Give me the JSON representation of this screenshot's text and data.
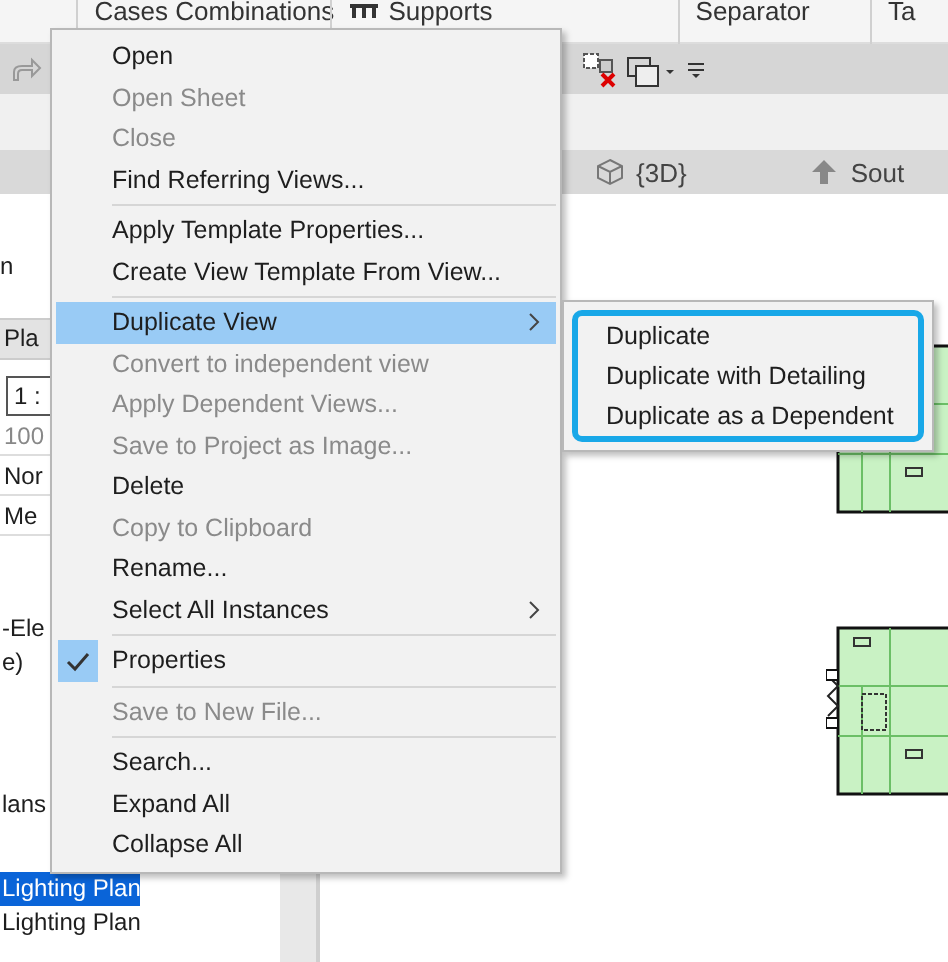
{
  "ribbon": {
    "groups": [
      {
        "label": "Cases  Combinations"
      },
      {
        "label": "Supports"
      },
      {
        "label": "Separator"
      },
      {
        "label": "Ta"
      }
    ]
  },
  "view_tabs": [
    {
      "label": "{3D}",
      "selected": false
    },
    {
      "label": "Sout",
      "selected": false
    }
  ],
  "properties_panel": {
    "text_1": "n",
    "header": "Pla",
    "scale_field": "1 :",
    "rows": [
      "100",
      "Nor",
      "Me"
    ]
  },
  "project_browser": {
    "items": [
      {
        "label": "-Ele",
        "selected": false
      },
      {
        "label": "e)",
        "selected": false
      },
      {
        "label": "lans",
        "selected": false
      },
      {
        "label": "Lighting Plan",
        "selected": true
      },
      {
        "label": "Lighting Plan",
        "selected": false
      }
    ]
  },
  "context_menu": {
    "items": [
      {
        "kind": "item",
        "label": "Open",
        "disabled": false,
        "selected": false,
        "checked": false,
        "submenu": false
      },
      {
        "kind": "item",
        "label": "Open Sheet",
        "disabled": true,
        "selected": false,
        "checked": false,
        "submenu": false
      },
      {
        "kind": "item",
        "label": "Close",
        "disabled": true,
        "selected": false,
        "checked": false,
        "submenu": false
      },
      {
        "kind": "item",
        "label": "Find Referring Views...",
        "disabled": false,
        "selected": false,
        "checked": false,
        "submenu": false
      },
      {
        "kind": "separator"
      },
      {
        "kind": "item",
        "label": "Apply Template Properties...",
        "disabled": false,
        "selected": false,
        "checked": false,
        "submenu": false
      },
      {
        "kind": "item",
        "label": "Create View Template From View...",
        "disabled": false,
        "selected": false,
        "checked": false,
        "submenu": false
      },
      {
        "kind": "separator"
      },
      {
        "kind": "item",
        "label": "Duplicate View",
        "disabled": false,
        "selected": true,
        "checked": false,
        "submenu": true
      },
      {
        "kind": "item",
        "label": "Convert to independent view",
        "disabled": true,
        "selected": false,
        "checked": false,
        "submenu": false
      },
      {
        "kind": "item",
        "label": "Apply Dependent Views...",
        "disabled": true,
        "selected": false,
        "checked": false,
        "submenu": false
      },
      {
        "kind": "item",
        "label": "Save to Project as Image...",
        "disabled": true,
        "selected": false,
        "checked": false,
        "submenu": false
      },
      {
        "kind": "item",
        "label": "Delete",
        "disabled": false,
        "selected": false,
        "checked": false,
        "submenu": false
      },
      {
        "kind": "item",
        "label": "Copy to Clipboard",
        "disabled": true,
        "selected": false,
        "checked": false,
        "submenu": false
      },
      {
        "kind": "item",
        "label": "Rename...",
        "disabled": false,
        "selected": false,
        "checked": false,
        "submenu": false
      },
      {
        "kind": "item",
        "label": "Select All Instances",
        "disabled": false,
        "selected": false,
        "checked": false,
        "submenu": true
      },
      {
        "kind": "separator"
      },
      {
        "kind": "item",
        "label": "Properties",
        "disabled": false,
        "selected": false,
        "checked": true,
        "submenu": false
      },
      {
        "kind": "separator"
      },
      {
        "kind": "item",
        "label": "Save to New File...",
        "disabled": true,
        "selected": false,
        "checked": false,
        "submenu": false
      },
      {
        "kind": "separator"
      },
      {
        "kind": "item",
        "label": "Search...",
        "disabled": false,
        "selected": false,
        "checked": false,
        "submenu": false
      },
      {
        "kind": "item",
        "label": "Expand All",
        "disabled": false,
        "selected": false,
        "checked": false,
        "submenu": false
      },
      {
        "kind": "item",
        "label": "Collapse All",
        "disabled": false,
        "selected": false,
        "checked": false,
        "submenu": false
      }
    ]
  },
  "submenu": {
    "highlighted": true,
    "items": [
      "Duplicate",
      "Duplicate with Detailing",
      "Duplicate as a Dependent"
    ]
  }
}
